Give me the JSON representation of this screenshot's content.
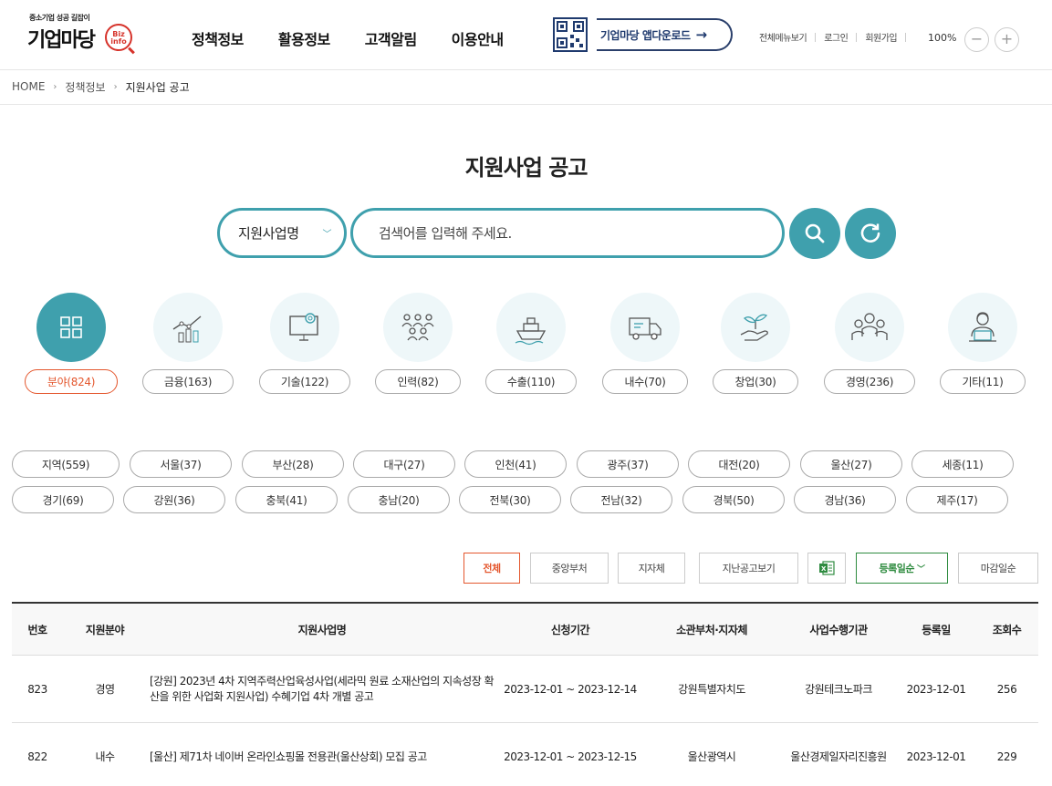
{
  "logo": {
    "tagline": "중소기업 성공 길잡이",
    "brand": "기업마당",
    "badge": "Biz info"
  },
  "nav": [
    "정책정보",
    "활용정보",
    "고객알림",
    "이용안내"
  ],
  "app_download": "기업마당 앱다운로드",
  "util": [
    "전체메뉴보기",
    "로그인",
    "회원가입"
  ],
  "zoom": {
    "value": "100%",
    "minus": "−",
    "plus": "+"
  },
  "breadcrumb": [
    "HOME",
    "정책정보",
    "지원사업 공고"
  ],
  "page_title": "지원사업 공고",
  "search": {
    "select_value": "지원사업명",
    "placeholder": "검색어를 입력해 주세요."
  },
  "categories": [
    {
      "label": "분야(824)",
      "icon": "grid-icon"
    },
    {
      "label": "금융(163)",
      "icon": "chart-icon"
    },
    {
      "label": "기술(122)",
      "icon": "monitor-gear-icon"
    },
    {
      "label": "인력(82)",
      "icon": "people-icon"
    },
    {
      "label": "수출(110)",
      "icon": "ship-icon"
    },
    {
      "label": "내수(70)",
      "icon": "truck-icon"
    },
    {
      "label": "창업(30)",
      "icon": "sprout-hand-icon"
    },
    {
      "label": "경영(236)",
      "icon": "team-icon"
    },
    {
      "label": "기타(11)",
      "icon": "person-laptop-icon"
    }
  ],
  "regions_row1": [
    "지역(559)",
    "서울(37)",
    "부산(28)",
    "대구(27)",
    "인천(41)",
    "광주(37)",
    "대전(20)",
    "울산(27)",
    "세종(11)"
  ],
  "regions_row2": [
    "경기(69)",
    "강원(36)",
    "충북(41)",
    "충남(20)",
    "전북(30)",
    "전남(32)",
    "경북(50)",
    "경남(36)",
    "제주(17)"
  ],
  "filters": {
    "all": "전체",
    "central": "중앙부처",
    "local": "지자체",
    "past": "지난공고보기",
    "reg_sort": "등록일순",
    "deadline_sort": "마감일순"
  },
  "table": {
    "headers": [
      "번호",
      "지원분야",
      "지원사업명",
      "신청기간",
      "소관부처·지자체",
      "사업수행기관",
      "등록일",
      "조회수"
    ],
    "rows": [
      [
        "823",
        "경영",
        "[강원] 2023년 4차 지역주력산업육성사업(세라믹 원료 소재산업의 지속성장 확산을 위한 사업화 지원사업) 수혜기업 4차 개별 공고",
        "2023-12-01 ~ 2023-12-14",
        "강원특별자치도",
        "강원테크노파크",
        "2023-12-01",
        "256"
      ],
      [
        "822",
        "내수",
        "[울산] 제71차 네이버 온라인쇼핑몰 전용관(울산상회) 모집 공고",
        "2023-12-01 ~ 2023-12-15",
        "울산광역시",
        "울산경제일자리진흥원",
        "2023-12-01",
        "229"
      ]
    ]
  },
  "colors": {
    "accent": "#3fa0ad",
    "active": "#e4572e",
    "green": "#2e8b3f"
  }
}
